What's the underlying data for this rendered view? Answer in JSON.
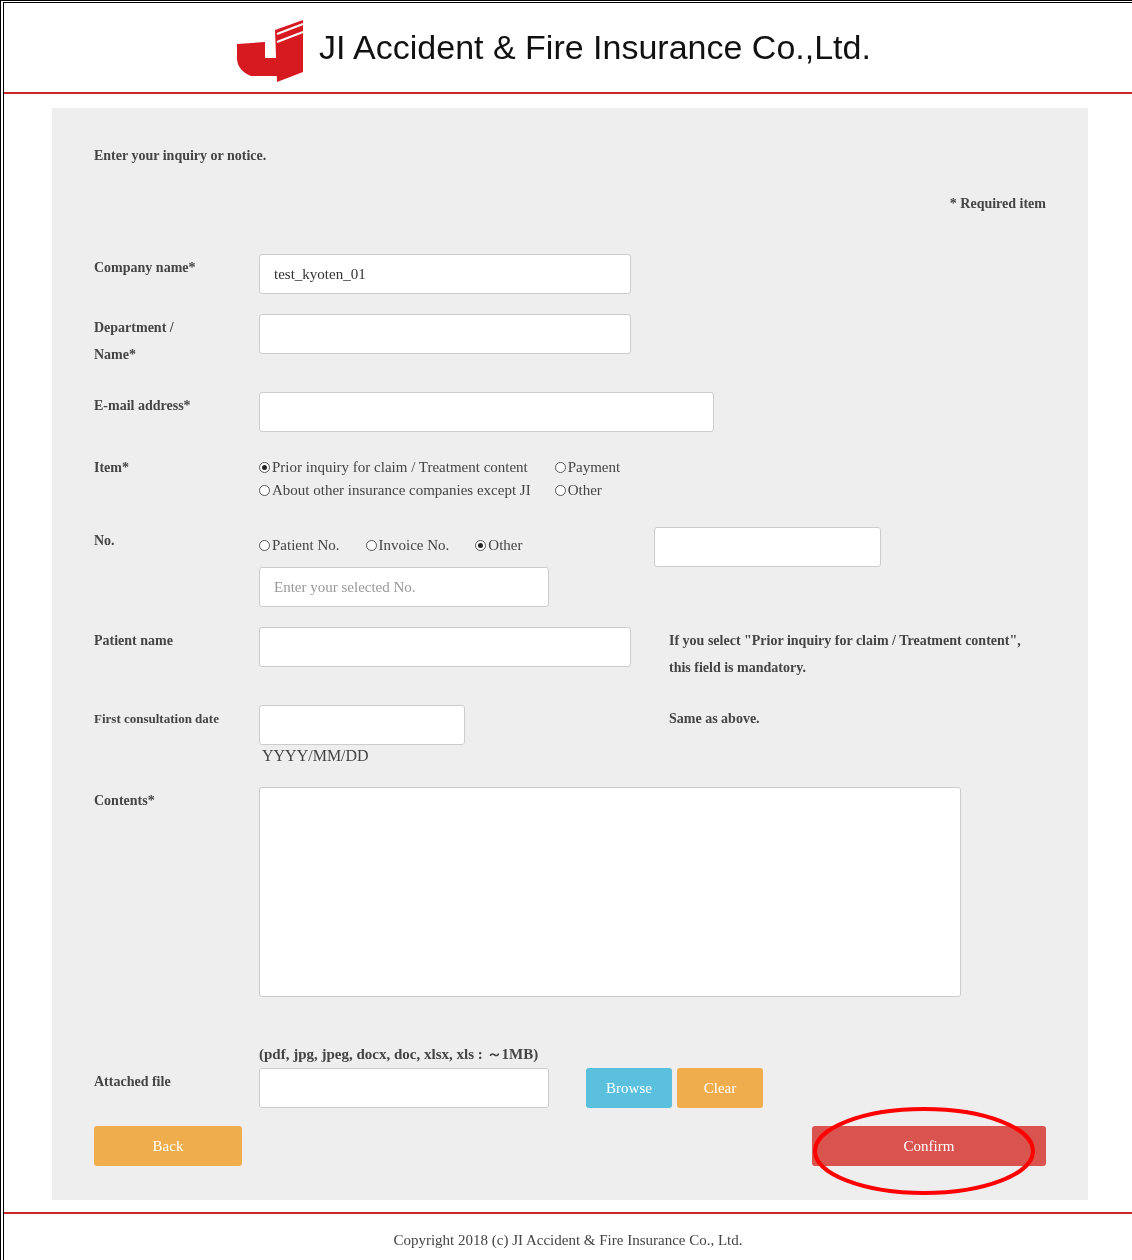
{
  "header": {
    "company": "JI Accident & Fire Insurance Co.,Ltd."
  },
  "form": {
    "intro": "Enter your inquiry or notice.",
    "required_note": "* Required item",
    "company_name": {
      "label": "Company name*",
      "value": "test_kyoten_01"
    },
    "department": {
      "label": "Department / Name*"
    },
    "email": {
      "label": "E-mail address*"
    },
    "item": {
      "label": "Item*",
      "options": [
        {
          "label": "Prior inquiry for claim / Treatment content",
          "selected": true
        },
        {
          "label": "Payment",
          "selected": false
        },
        {
          "label": "About other insurance companies except JI",
          "selected": false
        },
        {
          "label": "Other",
          "selected": false
        }
      ]
    },
    "number": {
      "label": "No.",
      "options": [
        {
          "label": "Patient No.",
          "selected": false
        },
        {
          "label": "Invoice No.",
          "selected": false
        },
        {
          "label": "Other",
          "selected": true
        }
      ],
      "placeholder": "Enter your selected No."
    },
    "patient_name": {
      "label": "Patient name",
      "note": "If you select \"Prior inquiry for claim / Treatment content\", this field is mandatory."
    },
    "first_consultation": {
      "label": "First consultation date",
      "hint": "YYYY/MM/DD",
      "note": "Same as above."
    },
    "contents": {
      "label": "Contents*"
    },
    "attached": {
      "formats": "(pdf, jpg, jpeg, docx, doc, xlsx, xls : ～1MB)",
      "label": "Attached file",
      "buttons": [
        {
          "label": "Browse",
          "kind": "browse"
        },
        {
          "label": "Clear",
          "kind": "clear"
        }
      ]
    },
    "actions": [
      {
        "label": "Back",
        "kind": "back",
        "circled": false
      },
      {
        "label": "Confirm",
        "kind": "confirm",
        "circled": true
      }
    ]
  },
  "footer": {
    "copyright": "Copyright 2018 (c) JI Accident & Fire Insurance Co., Ltd."
  }
}
